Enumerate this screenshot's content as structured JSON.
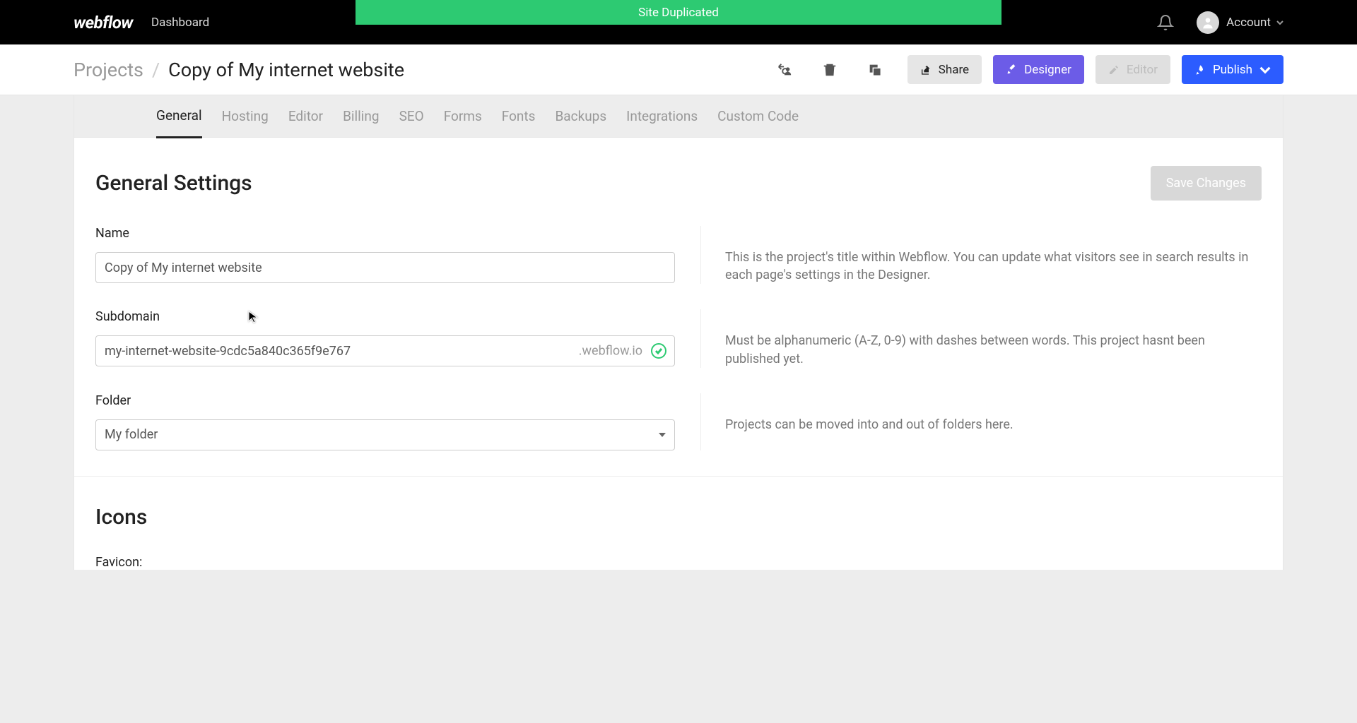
{
  "toast": {
    "message": "Site Duplicated",
    "color": "#2dca72"
  },
  "topbar": {
    "logo": "webflow",
    "nav_dashboard": "Dashboard",
    "account_label": "Account"
  },
  "header": {
    "breadcrumb_root": "Projects",
    "breadcrumb_current": "Copy of My internet website",
    "share_label": "Share",
    "designer_label": "Designer",
    "editor_label": "Editor",
    "publish_label": "Publish"
  },
  "tabs": [
    {
      "label": "General",
      "active": true
    },
    {
      "label": "Hosting"
    },
    {
      "label": "Editor"
    },
    {
      "label": "Billing"
    },
    {
      "label": "SEO"
    },
    {
      "label": "Forms"
    },
    {
      "label": "Fonts"
    },
    {
      "label": "Backups"
    },
    {
      "label": "Integrations"
    },
    {
      "label": "Custom Code"
    }
  ],
  "general": {
    "title": "General Settings",
    "save_label": "Save Changes",
    "name_label": "Name",
    "name_value": "Copy of My internet website",
    "name_help": "This is the project's title within Webflow. You can update what visitors see in search results in each page's settings in the Designer.",
    "subdomain_label": "Subdomain",
    "subdomain_value": "my-internet-website-9cdc5a840c365f9e767",
    "subdomain_suffix": ".webflow.io",
    "subdomain_help": "Must be alphanumeric (A-Z, 0-9) with dashes between words. This project hasnt been published yet.",
    "folder_label": "Folder",
    "folder_value": "My folder",
    "folder_help": "Projects can be moved into and out of folders here."
  },
  "icons": {
    "title": "Icons",
    "favicon_label": "Favicon:"
  },
  "colors": {
    "purple": "#6c5ce7",
    "blue": "#2c5cff",
    "green": "#2dca72"
  }
}
